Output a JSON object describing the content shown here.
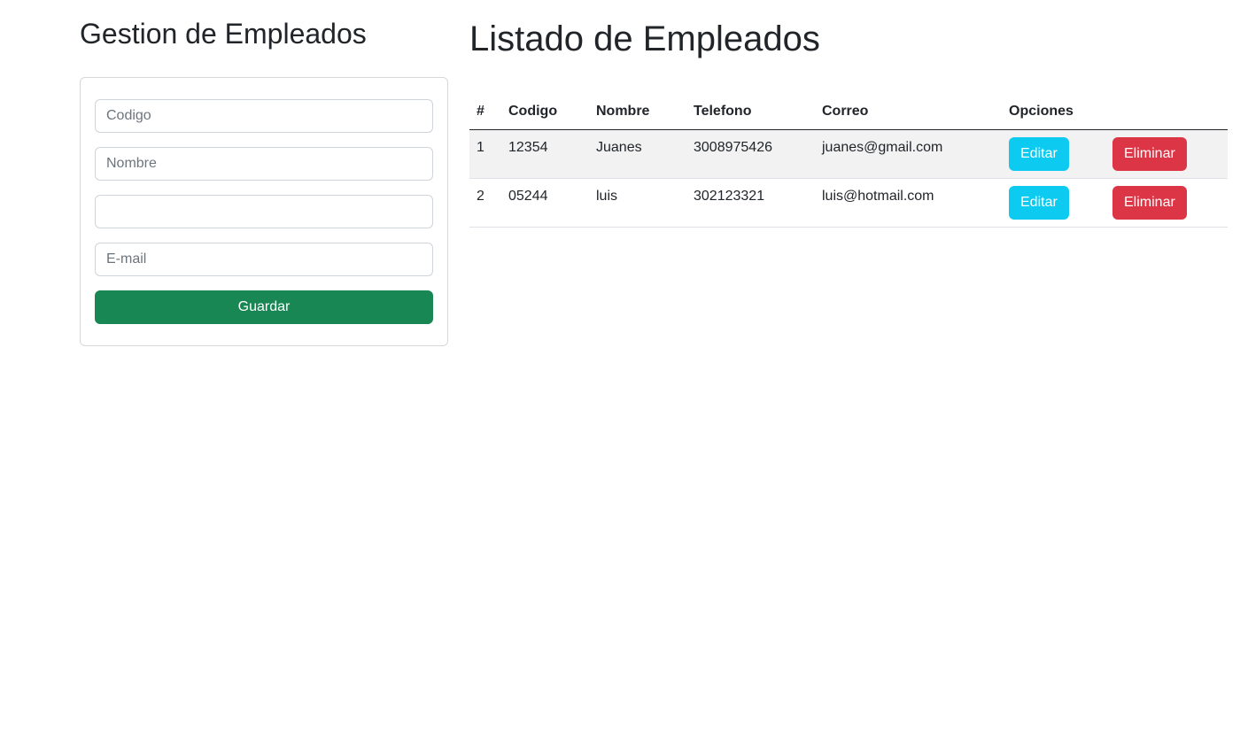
{
  "form": {
    "title": "Gestion de Empleados",
    "codigo_placeholder": "Codigo",
    "codigo_value": "",
    "nombre_placeholder": "Nombre",
    "nombre_value": "",
    "telefono_placeholder": "",
    "telefono_value": "",
    "email_placeholder": "E-mail",
    "email_value": "",
    "save_label": "Guardar"
  },
  "list": {
    "title": "Listado de Empleados",
    "headers": {
      "num": "#",
      "codigo": "Codigo",
      "nombre": "Nombre",
      "telefono": "Telefono",
      "correo": "Correo",
      "opciones": "Opciones"
    },
    "rows": [
      {
        "num": "1",
        "codigo": "12354",
        "nombre": "Juanes",
        "telefono": "3008975426",
        "correo": "juanes@gmail.com",
        "edit_label": "Editar",
        "delete_label": "Eliminar"
      },
      {
        "num": "2",
        "codigo": "05244",
        "nombre": "luis",
        "telefono": "302123321",
        "correo": "luis@hotmail.com",
        "edit_label": "Editar",
        "delete_label": "Eliminar"
      }
    ]
  },
  "colors": {
    "save_button": "#198754",
    "edit_button": "#0dcaf0",
    "delete_button": "#dc3545",
    "striped_row": "#f2f2f2"
  }
}
